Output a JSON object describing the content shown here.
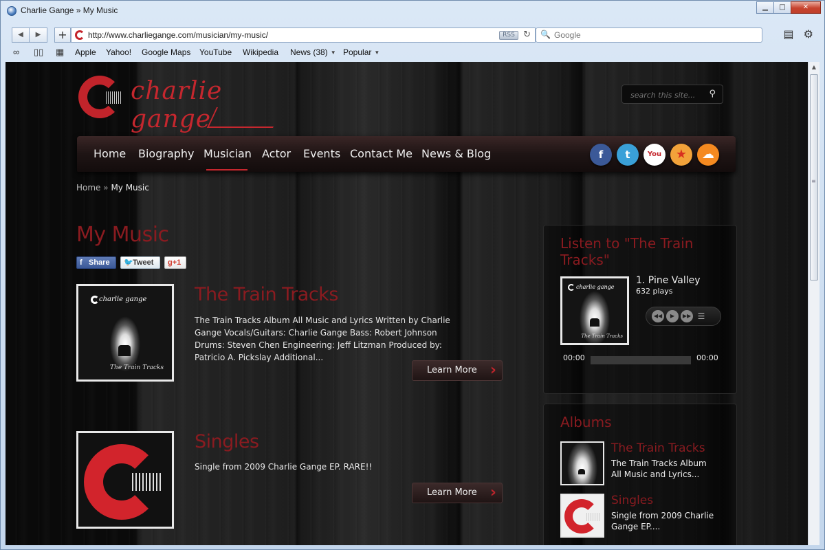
{
  "window": {
    "title": "Charlie Gange » My Music",
    "minimize": "▁",
    "maximize": "□",
    "close": "✕"
  },
  "toolbar": {
    "back_glyph": "◀",
    "forward_glyph": "▶",
    "new_tab_glyph": "+",
    "url": "http://www.charliegange.com/musician/my-music/",
    "rss_label": "RSS",
    "reload_glyph": "↻",
    "search_glyph": "🔍",
    "search_placeholder": "Google",
    "page_menu_glyph": "▤",
    "settings_glyph": "⚙"
  },
  "bookmarks": {
    "reader_glyph": "∞",
    "book_glyph": "▯▯",
    "grid_glyph": "▦",
    "items": [
      {
        "label": "Apple"
      },
      {
        "label": "Yahoo!"
      },
      {
        "label": "Google Maps"
      },
      {
        "label": "YouTube"
      },
      {
        "label": "Wikipedia"
      },
      {
        "label": "News (38)"
      },
      {
        "label": "Popular"
      }
    ],
    "caret": "▼"
  },
  "site": {
    "logo_text": "charlie gange",
    "search_placeholder": "search this site...",
    "search_glyph": "⚲",
    "nav": [
      {
        "label": "Home"
      },
      {
        "label": "Biography"
      },
      {
        "label": "Musician"
      },
      {
        "label": "Actor"
      },
      {
        "label": "Events"
      },
      {
        "label": "Contact Me"
      },
      {
        "label": "News & Blog"
      }
    ],
    "social": [
      {
        "label": "f",
        "color": "#3b5998"
      },
      {
        "label": "t",
        "color": "#3aa0d8"
      },
      {
        "label": "You",
        "color": "#ffffff"
      },
      {
        "label": "★",
        "color": "#f2a23a"
      },
      {
        "label": "☁",
        "color": "#f58a20"
      }
    ],
    "accent_color": "#8a1b20"
  },
  "breadcrumb": {
    "home": "Home",
    "sep": "»",
    "current": "My Music"
  },
  "page": {
    "title": "My Music",
    "share": {
      "facebook": "Share",
      "twitter": "Tweet",
      "gplus": "+1",
      "fb_glyph": "f",
      "tw_glyph": "🐦",
      "gp_glyph": "g"
    }
  },
  "entries": [
    {
      "title": "The Train Tracks",
      "text": "The Train Tracks Album All Music and Lyrics Written by Charlie Gange Vocals/Guitars: Charlie Gange Bass: Robert Johnson Drums: Steven Chen Engineering: Jeff Litzman Produced by: Patricio A. Pickslay Additional...",
      "button": "Learn More",
      "cover_logo": "charlie gange",
      "cover_caption": "The Train Tracks"
    },
    {
      "title": "Singles",
      "text": "Single from 2009 Charlie Gange EP.  RARE!!",
      "button": "Learn More"
    }
  ],
  "player": {
    "title": "Listen to \"The Train Tracks\"",
    "track": "1. Pine Valley",
    "plays": "632 plays",
    "time_start": "00:00",
    "time_end": "00:00",
    "cover_logo": "charlie gange",
    "cover_caption": "The Train Tracks",
    "ctrl_prev": "◀◀",
    "ctrl_play": "▶",
    "ctrl_next": "▶▶",
    "ctrl_list": "☰"
  },
  "albums": {
    "title": "Albums",
    "items": [
      {
        "name": "The Train Tracks",
        "desc": "The Train Tracks Album All Music and Lyrics..."
      },
      {
        "name": "Singles",
        "desc": "Single from 2009 Charlie Gange EP...."
      }
    ]
  },
  "scroll": {
    "up": "▲",
    "grip": "≡"
  }
}
